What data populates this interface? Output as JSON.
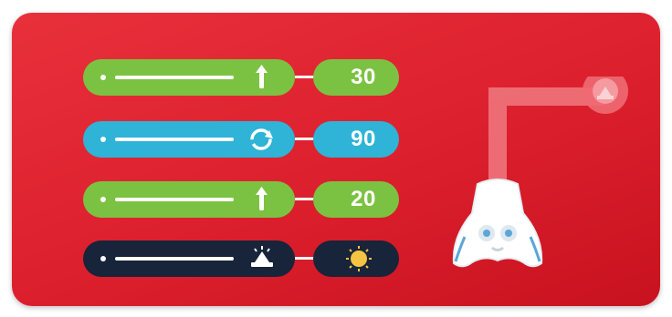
{
  "colors": {
    "card": "#dc1f2d",
    "move_block": "#7cc242",
    "turn_block": "#2fb3d6",
    "sound_block": "#17243a",
    "sound_value": "#f6c443"
  },
  "blocks": [
    {
      "icon": "arrow-up-icon",
      "value": "30",
      "color": "#7cc242"
    },
    {
      "icon": "rotate-icon",
      "value": "90",
      "color": "#2fb3d6"
    },
    {
      "icon": "arrow-up-icon",
      "value": "20",
      "color": "#7cc242"
    },
    {
      "icon": "sound-icon",
      "value_icon": "sun-icon",
      "color": "#17243a"
    }
  ],
  "robot": {
    "icon": "robot-icon",
    "target_icon": "sound-icon"
  }
}
